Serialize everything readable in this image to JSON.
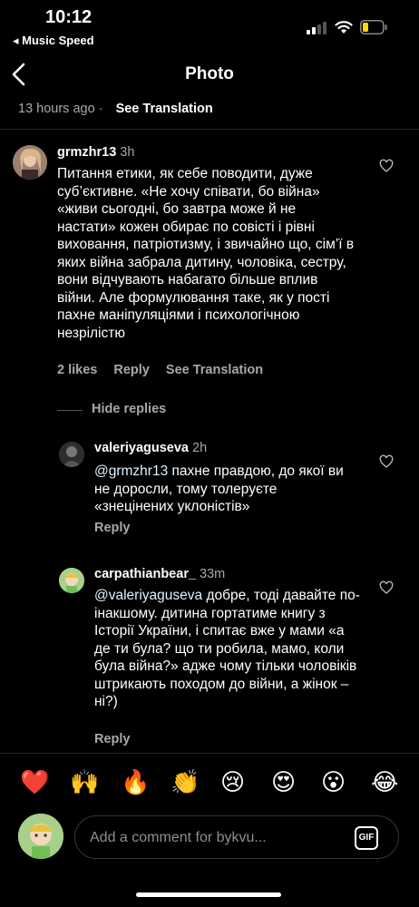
{
  "status_bar": {
    "time": "10:12",
    "back_app": "◂ Music Speed"
  },
  "header": {
    "title": "Photo",
    "back_icon": "chevron-left-icon"
  },
  "caption_meta": {
    "time_ago": "13 hours ago",
    "separator": "·",
    "see_translation": "See Translation"
  },
  "comments": [
    {
      "username": "grmzhr13",
      "time": "3h",
      "text": "Питання етики, як себе поводити, дуже суб’єктивне. «Не хочу співати, бо війна» «живи сьогодні, бо завтра може й не настати» кожен обирає по совісті і рівні виховання, патріотизму, і звичайно що, сім’ї в яких війна забрала дитину, чоловіка, сестру, вони відчувають набагато більше вплив війни. Але формулювання таке, як у пості пахне маніпуляціями і психологічною незрілістю",
      "likes": "2 likes",
      "reply": "Reply",
      "see_translation": "See Translation"
    }
  ],
  "hide_replies": "Hide replies",
  "replies": [
    {
      "username": "valeriyaguseva",
      "time": "2h",
      "mention": "@grmzhr13",
      "text": " пахне правдою, до якої ви не доросли, тому толеруєте «знецінених уклоністів»",
      "reply": "Reply"
    },
    {
      "username": "carpathianbear_",
      "time": "33m",
      "mention": "@valeriyaguseva",
      "text": " добре, тоді давайте по-інакшому. дитина гортатиме книгу з Історії України, і спитає вже у мами «а де ти була? що ти робила, мамо, коли була війна?» адже чому тільки чоловіків штрикають походом до війни, а жінок – ні?)",
      "reply": "Reply"
    }
  ],
  "emoji_bar": [
    "❤️",
    "🙌",
    "🔥",
    "👏",
    "😢",
    "😍",
    "😮",
    "😂"
  ],
  "input": {
    "placeholder": "Add a comment for bykvu...",
    "gif_label": "GIF"
  }
}
